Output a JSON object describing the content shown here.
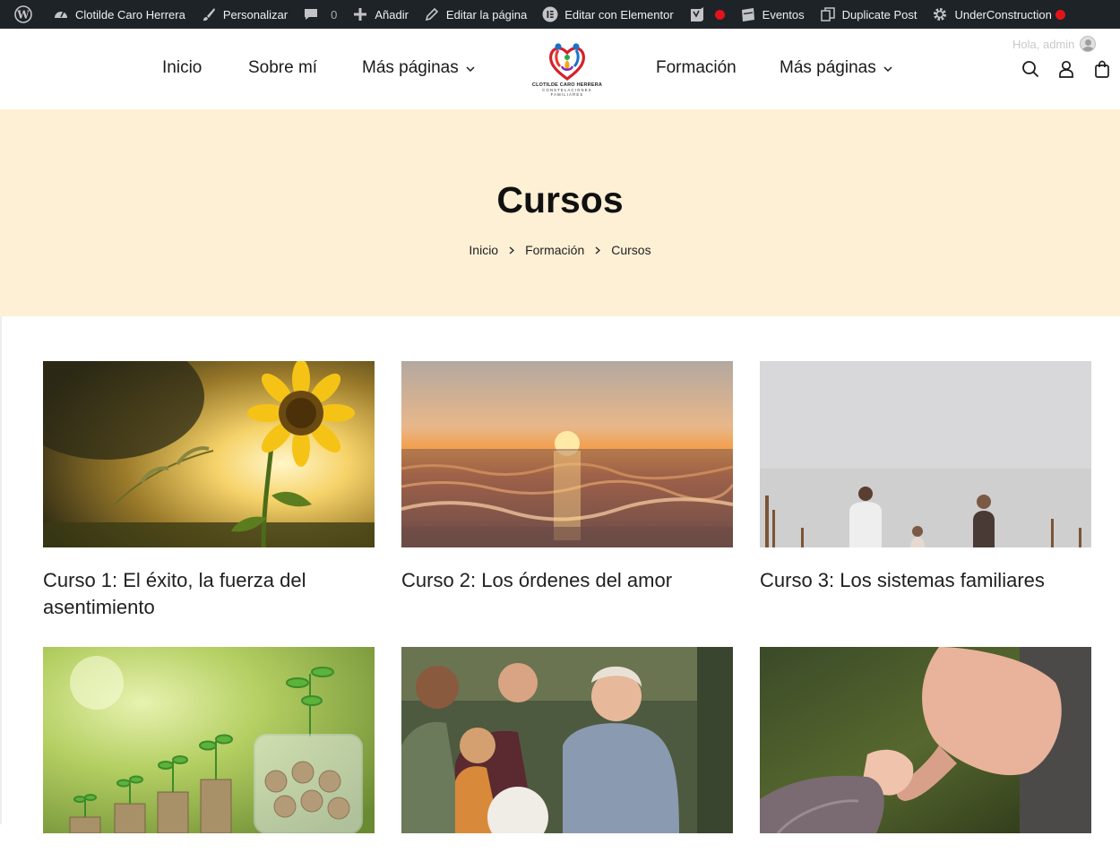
{
  "admin_bar": {
    "site_name": "Clotilde Caro Herrera",
    "customize": "Personalizar",
    "comments_count": "0",
    "add_new": "Añadir",
    "edit_page": "Editar la página",
    "edit_elementor": "Editar con Elementor",
    "events": "Eventos",
    "duplicate_post": "Duplicate Post",
    "under_construction": "UnderConstruction"
  },
  "header": {
    "nav_left": [
      "Inicio",
      "Sobre mí",
      "Más páginas"
    ],
    "nav_right": [
      "Formación",
      "Más páginas"
    ],
    "logo_name": "CLOTILDE CARO HERRERA",
    "logo_tagline": "CONSTELACIONES FAMILIARES",
    "greeting": "Hola, admin"
  },
  "hero": {
    "title": "Cursos",
    "breadcrumb": [
      "Inicio",
      "Formación",
      "Cursos"
    ]
  },
  "courses": [
    {
      "title": "Curso 1: El éxito, la fuerza del asentimiento",
      "image": "sunflower-sunset"
    },
    {
      "title": "Curso 2: Los órdenes del amor",
      "image": "ocean-sunset"
    },
    {
      "title": "Curso 3: Los sistemas familiares",
      "image": "family-walking"
    },
    {
      "title": "",
      "image": "coin-plants"
    },
    {
      "title": "",
      "image": "family-laughing"
    },
    {
      "title": "",
      "image": "holding-hands"
    }
  ],
  "colors": {
    "admin_bar_bg": "#1d2327",
    "hero_bg": "#fdf0d5",
    "notification_red": "#e1141c"
  }
}
